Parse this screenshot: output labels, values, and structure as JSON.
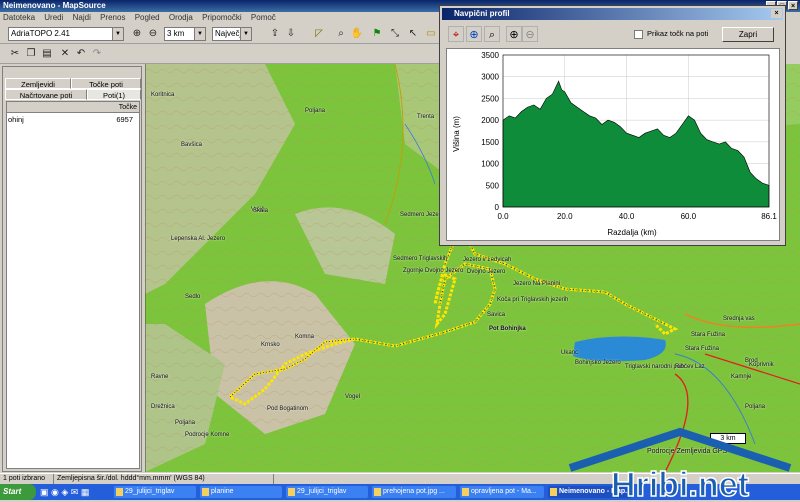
{
  "window": {
    "title": "Neimenovano - MapSource"
  },
  "menu": [
    "Datoteka",
    "Uredi",
    "Najdi",
    "Prenos",
    "Pogled",
    "Orodja",
    "Pripomočki",
    "Pomoč"
  ],
  "toolbar": {
    "map_product": "AdriaTOPO 2.41",
    "zoom_value": "3 km",
    "detail_level": "Največje"
  },
  "left_panel": {
    "tabs_row1": [
      "Zemljevidi",
      "Točke poti"
    ],
    "tabs_row2": [
      "Načrtovane poti",
      "Poti(1)"
    ],
    "list_header": "Točke",
    "rows": [
      {
        "name": "ohinj",
        "value": "6957"
      }
    ]
  },
  "map": {
    "labels": [
      "Bavšica",
      "Trenta",
      "Sedmero Triglavskih",
      "Jezero v Ledvicah",
      "Jezero Na Planini",
      "Zgornje Dvojno Jezero",
      "Dvojno Jezero",
      "Koča pri Triglavskih jezerih",
      "Lepenska Al. Jezero",
      "Vršič",
      "Sedmero Jezero",
      "Ukanc",
      "Stara Fužina",
      "Savica",
      "Srednja vas",
      "Koprivnik",
      "Ravne",
      "Stara Fužina",
      "Pod Bogatinom",
      "Krnsko",
      "Vogel",
      "Komna",
      "Podrocje Komne",
      "Triglavski narodni park",
      "Bohinjsko Jezero",
      "Ribčev Laz",
      "Kamnje",
      "Brod",
      "Drežnica",
      "Sedlo",
      "Poljana",
      "Poljana",
      "Poljana",
      "Skala",
      "Koritnica"
    ],
    "route_label": "Pot Bohinjka",
    "scale": "3 km",
    "copyright": "Podrocje Zemljevida GPS"
  },
  "elevation": {
    "title": "Navpični profil",
    "checkbox_label": "Prikaz točk na poti",
    "close_label": "Zapri",
    "ylabel": "Višina  (m)",
    "xlabel": "Razdalja    (km)"
  },
  "chart_data": {
    "type": "area",
    "title": "",
    "xlabel": "Razdalja (km)",
    "ylabel": "Višina (m)",
    "xlim": [
      0,
      86.1
    ],
    "ylim": [
      0,
      3500
    ],
    "x_ticks": [
      "0.0",
      "20.0",
      "40.0",
      "60.0",
      "86.1"
    ],
    "y_ticks": [
      "0",
      "500",
      "1000",
      "1500",
      "2000",
      "2500",
      "3000",
      "3500"
    ],
    "x": [
      0,
      2,
      4,
      6,
      8,
      10,
      12,
      14,
      16,
      18,
      19,
      20,
      22,
      24,
      26,
      28,
      30,
      32,
      34,
      36,
      38,
      40,
      42,
      44,
      46,
      48,
      50,
      52,
      54,
      56,
      58,
      60,
      62,
      64,
      66,
      68,
      70,
      72,
      74,
      76,
      78,
      80,
      82,
      84,
      86.1
    ],
    "values": [
      2000,
      2100,
      2050,
      2200,
      2300,
      2350,
      2250,
      2500,
      2600,
      2900,
      2700,
      2650,
      2400,
      2300,
      2200,
      2100,
      2050,
      1900,
      2000,
      1950,
      1850,
      1700,
      1650,
      1600,
      1700,
      1750,
      1800,
      1650,
      1600,
      1700,
      1900,
      2100,
      2000,
      1700,
      1550,
      1500,
      1450,
      1500,
      1350,
      1300,
      1150,
      800,
      650,
      550,
      500
    ],
    "grid": true,
    "fill": "#0e8c3a"
  },
  "status": {
    "items": [
      "1 poti izbrano",
      "Zemljepisna šir./dol. hddd°mm.mmm' (WGS 84)"
    ]
  },
  "taskbar": {
    "start_label": "Start",
    "tasks": [
      "29_julijci_triglav",
      "planine",
      "29_julijci_triglav",
      "prehojena pot.jpg ...",
      "opravljena pot - Ma...",
      "Neimenovano - Map..."
    ]
  },
  "watermark": {
    "text": "Hribi.net"
  },
  "colors": {
    "title_blue": "#0a246a",
    "map_green": "#7cc43c",
    "route_yellow": "#ffe600",
    "taskbar_blue": "#245edb",
    "lake_blue": "#2a8ad6"
  }
}
